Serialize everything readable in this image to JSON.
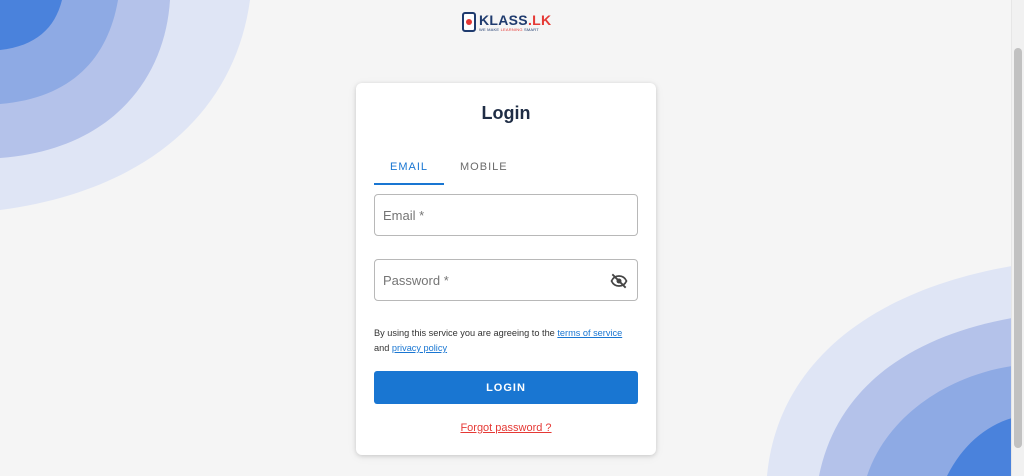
{
  "brand": {
    "name_main": "KLASS",
    "name_dot": ".",
    "name_suffix": "LK",
    "tagline_pre": "WE MAKE ",
    "tagline_highlight": "LEARNING",
    "tagline_post": " SMART"
  },
  "login": {
    "title": "Login",
    "tabs": [
      {
        "label": "EMAIL",
        "active": true
      },
      {
        "label": "MOBILE",
        "active": false
      }
    ],
    "email_placeholder": "Email *",
    "password_placeholder": "Password *",
    "password_toggle_icon": "eye-off-icon",
    "terms_prefix": "By using this service you are agreeing to the ",
    "terms_link": "terms of service",
    "terms_middle": "and ",
    "privacy_link": "privacy policy",
    "submit_label": "LOGIN",
    "forgot_label": "Forgot password ?"
  },
  "colors": {
    "accent": "#1976d2",
    "danger": "#e53935",
    "wave_light": "#dfe5f5",
    "wave_mid": "#b4c2ea",
    "wave_dark": "#8eaae4",
    "wave_deep": "#4a82dc"
  }
}
